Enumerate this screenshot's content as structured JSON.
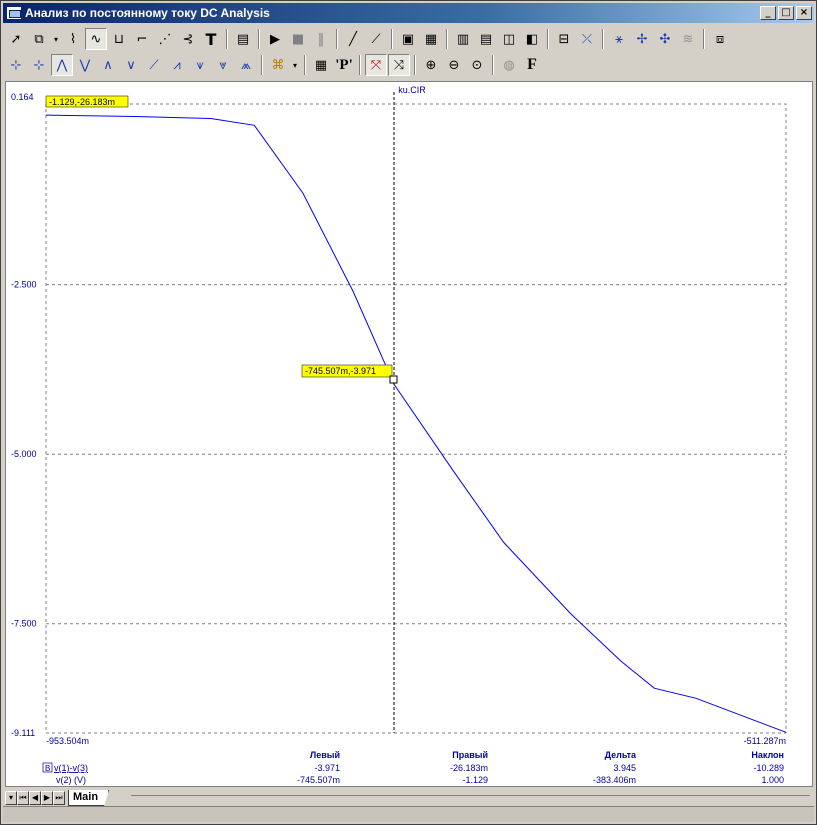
{
  "window": {
    "title": "Анализ по постоянному току DC Analysis",
    "buttons": [
      "_",
      "□",
      "×"
    ]
  },
  "toolbar1": {
    "icons": [
      "select-arrow-icon",
      "component-icon",
      "dropdown-icon",
      "wire-icon",
      "waveform-icon",
      "scope-icon",
      "probe-icon",
      "node-icon",
      "text-T-icon",
      "properties-icon",
      "run-icon",
      "stop-icon",
      "pause-icon",
      "line-icon",
      "diagonal-line-icon",
      "box-icon",
      "grid-icon",
      "bars1-icon",
      "bars2-icon",
      "bars3-icon",
      "bars4-icon",
      "hline-icon",
      "cursor-icon",
      "marker1-icon",
      "marker2-icon",
      "marker3-icon",
      "wave-icon",
      "export-icon"
    ]
  },
  "toolbar2": {
    "icons": [
      "left-cursor-icon",
      "right-cursor-icon",
      "peak-icon",
      "valley-icon",
      "high-icon",
      "low-icon",
      "slope-icon",
      "inflect-icon",
      "global-high-icon",
      "global-low-icon",
      "top-icon",
      "bottom-icon",
      "table-icon",
      "point-P-icon",
      "tag-left-icon",
      "tag-right-icon",
      "zoom-in-icon",
      "zoom-out-icon",
      "zoom-fit-icon",
      "color-icon",
      "font-F-icon"
    ]
  },
  "plot": {
    "filename": "ku.CIR",
    "y_ticks": [
      "0.164",
      "-2.500",
      "-5.000",
      "-7.500",
      "-9.111"
    ],
    "x_left": "-953.504m",
    "x_right": "-511.287m",
    "cursor_left_label": "-1.129,-26.183m",
    "cursor_mid_label": "-745.507m,-3.971",
    "line_color": "#0000ff",
    "grid_color": "#808080",
    "axis_text_color": "#0000a0"
  },
  "chart_data": {
    "type": "line",
    "x": [
      -0.9535,
      -0.9,
      -0.855,
      -0.829,
      -0.8,
      -0.77,
      -0.7455,
      -0.71,
      -0.68,
      -0.64,
      -0.61,
      -0.59,
      -0.565,
      -0.5113
    ],
    "series": [
      {
        "values": [
          0.0,
          -0.02,
          -0.05,
          -0.15,
          -1.15,
          -2.6,
          -3.971,
          -5.25,
          -6.3,
          -7.35,
          -8.05,
          -8.45,
          -8.6,
          -9.1
        ]
      }
    ],
    "xlim": [
      -0.9535,
      -0.5113
    ],
    "ylim": [
      -9.111,
      0.164
    ],
    "grid": true
  },
  "table": {
    "headers": [
      "Левый",
      "Правый",
      "Дельта",
      "Наклон"
    ],
    "rows": [
      {
        "name": "v(1)-v(3)",
        "values": [
          "-3.971",
          "-26.183m",
          "3.945",
          "-10.289"
        ]
      },
      {
        "name": "v(2) (V)",
        "values": [
          "-745.507m",
          "-1.129",
          "-383.406m",
          "1.000"
        ]
      }
    ],
    "row_marker": "B"
  },
  "tabs": {
    "nav": [
      "▾",
      "⏮",
      "◀",
      "▶",
      "⏭"
    ],
    "active": "Main"
  }
}
